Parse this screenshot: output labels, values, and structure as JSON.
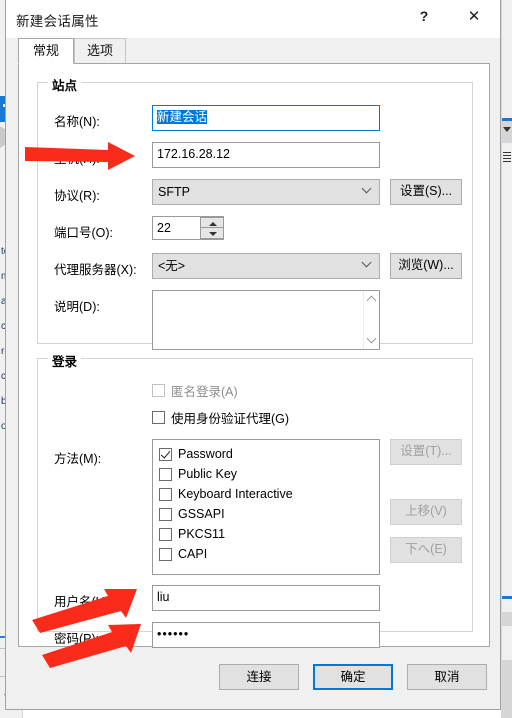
{
  "window": {
    "title": "新建会话属性",
    "help_label": "?",
    "close_label": "✕"
  },
  "tabs": [
    {
      "label": "常规",
      "active": true
    },
    {
      "label": "选项",
      "active": false
    }
  ],
  "site_group": {
    "title": "站点",
    "name_label": "名称(N):",
    "name_value": "新建会话",
    "host_label": "主机(H):",
    "host_value": "172.16.28.12",
    "protocol_label": "协议(R):",
    "protocol_value": "SFTP",
    "protocol_settings_button": "设置(S)...",
    "port_label": "端口号(O):",
    "port_value": "22",
    "proxy_label": "代理服务器(X):",
    "proxy_value": "<无>",
    "proxy_browse_button": "浏览(W)...",
    "description_label": "说明(D):",
    "description_value": ""
  },
  "login_group": {
    "title": "登录",
    "anonymous_label": "匿名登录(A)",
    "anonymous_checked": false,
    "anonymous_disabled": true,
    "agent_label": "使用身份验证代理(G)",
    "agent_checked": false,
    "method_label": "方法(M):",
    "methods": [
      {
        "label": "Password",
        "checked": true
      },
      {
        "label": "Public Key",
        "checked": false
      },
      {
        "label": "Keyboard Interactive",
        "checked": false
      },
      {
        "label": "GSSAPI",
        "checked": false
      },
      {
        "label": "PKCS11",
        "checked": false
      },
      {
        "label": "CAPI",
        "checked": false
      }
    ],
    "method_settings_button": "设置(T)...",
    "move_up_button": "上移(V)",
    "move_down_button": "下へ(E)",
    "username_label": "用户名(U):",
    "username_value": "liu",
    "password_label": "密码(P):",
    "password_value": "••••••"
  },
  "footer": {
    "connect_button": "连接",
    "ok_button": "确定",
    "cancel_button": "取消"
  },
  "annotations": {
    "arrow_color": "#fb2b1c",
    "count": 3
  },
  "background": {
    "left_text_fragments": [
      "tc",
      "m",
      "alo",
      "c",
      "re",
      "c",
      "bla",
      "os"
    ]
  },
  "colors": {
    "accent": "#0078d7",
    "selection": "#0078d7",
    "dialog_bg": "#f0f0f0",
    "panel_bg": "#ffffff",
    "control_bg": "#e1e1e1"
  }
}
